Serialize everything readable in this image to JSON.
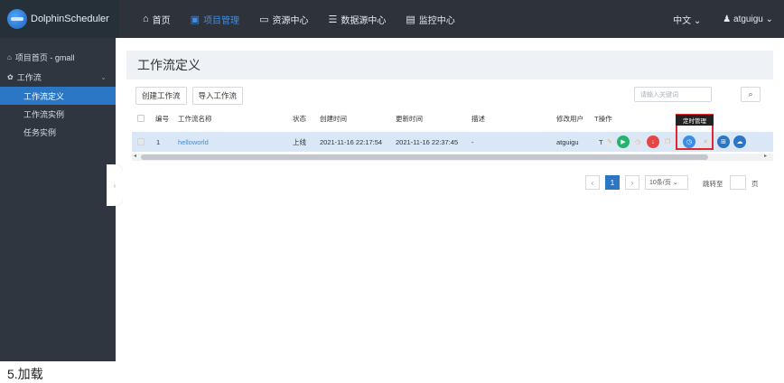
{
  "app": {
    "name": "DolphinScheduler"
  },
  "nav": [
    {
      "icon": "⌂",
      "icon_name": "home-icon",
      "label": "首页"
    },
    {
      "icon": "▣",
      "icon_name": "project-icon",
      "label": "项目管理"
    },
    {
      "icon": "▭",
      "icon_name": "folder-icon",
      "label": "资源中心"
    },
    {
      "icon": "☰",
      "icon_name": "database-icon",
      "label": "数据源中心"
    },
    {
      "icon": "▤",
      "icon_name": "monitor-icon",
      "label": "监控中心"
    }
  ],
  "header": {
    "language": "中文",
    "user": "atguigu"
  },
  "sidebar": {
    "project_home": "项目首页 - gmall",
    "group": "工作流",
    "items": [
      {
        "label": "工作流定义"
      },
      {
        "label": "工作流实例"
      },
      {
        "label": "任务实例"
      }
    ]
  },
  "page": {
    "title": "工作流定义",
    "create_button": "创建工作流",
    "import_button": "导入工作流",
    "search_placeholder": "请输入关键词"
  },
  "table": {
    "headers": {
      "no": "编号",
      "name": "工作流名称",
      "state": "状态",
      "create_time": "创建时间",
      "update_time": "更新时间",
      "description": "描述",
      "modify_user": "修改用户",
      "operation": "操作"
    },
    "rows": [
      {
        "no": "1",
        "name": "helloworld",
        "state": "上线",
        "create_time": "2021-11-16 22:17:54",
        "update_time": "2021-11-16 22:37:45",
        "description": "-",
        "modify_user": "atguigu",
        "timing_short": "T"
      }
    ],
    "tooltip": "定时管理"
  },
  "operations": [
    {
      "icon_name": "edit-icon",
      "color": "#e3e7ec"
    },
    {
      "icon_name": "run-icon",
      "color": "#27b36b"
    },
    {
      "icon_name": "timing-faded-icon",
      "color": "#e3e7ec"
    },
    {
      "icon_name": "offline-icon",
      "color": "#e54545"
    },
    {
      "icon_name": "copy-faded-icon",
      "color": "#e3e7ec"
    },
    {
      "icon_name": "timing-management-icon",
      "color": "#3a8ee6"
    },
    {
      "icon_name": "delete-faded-icon",
      "color": "#e3e7ec"
    },
    {
      "icon_name": "tree-view-icon",
      "color": "#2c76c6"
    },
    {
      "icon_name": "export-icon",
      "color": "#2c76c6"
    }
  ],
  "pagination": {
    "current_page": "1",
    "page_size": "10条/页",
    "jump_label": "跳转至",
    "page_unit": "页"
  },
  "footer_text": "5.加载"
}
